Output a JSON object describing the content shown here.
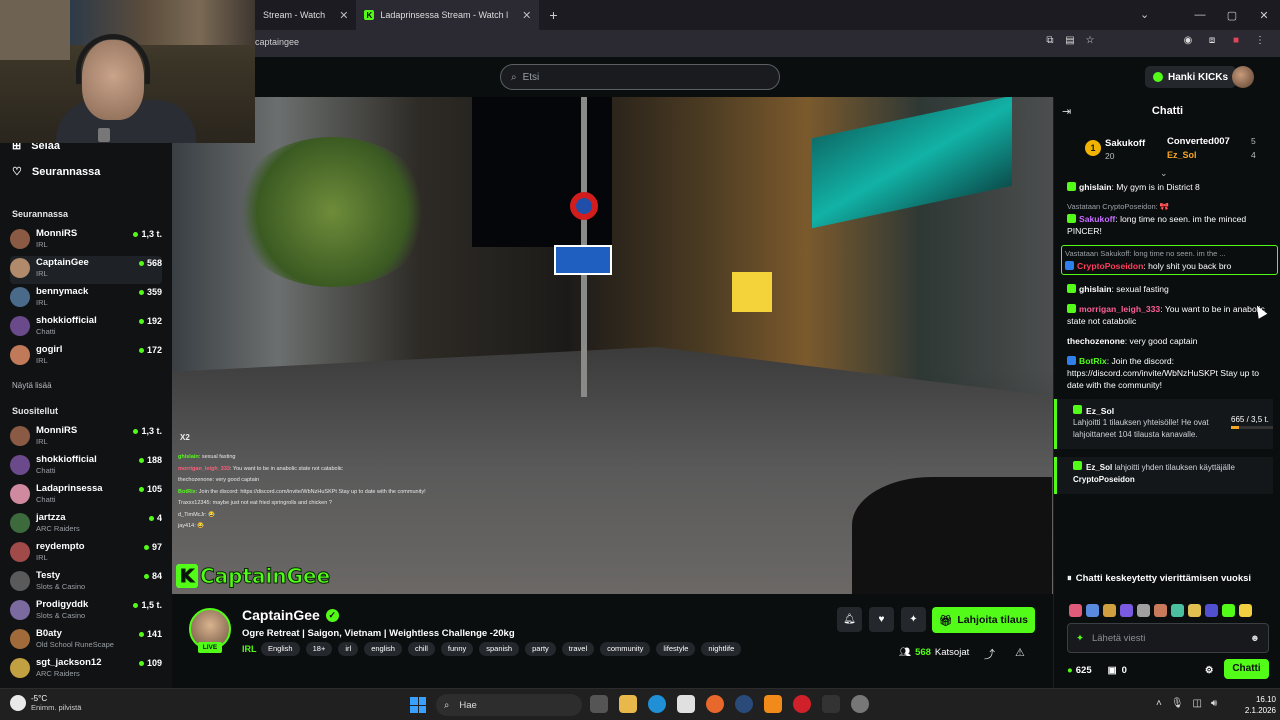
{
  "browser": {
    "tabs": [
      {
        "label": "Stream - Watch"
      },
      {
        "label": "Ladaprinsessa Stream - Watch l"
      }
    ],
    "new_tab": "+",
    "url": "captaingee",
    "window_controls": [
      "⌄",
      "—",
      "▢",
      "✕"
    ]
  },
  "header": {
    "search_placeholder": "Etsi",
    "get_kicks": "Hanki KICKs"
  },
  "sidebar": {
    "nav": [
      {
        "label": "Selaa"
      },
      {
        "label": "Seurannassa"
      }
    ],
    "following_title": "Seurannassa",
    "following": [
      {
        "name": "MonniRS",
        "category": "IRL",
        "viewers": "1,3 t.",
        "color": "#8a5a44"
      },
      {
        "name": "CaptainGee",
        "category": "IRL",
        "viewers": "568",
        "color": "#b08a6a"
      },
      {
        "name": "bennymack",
        "category": "IRL",
        "viewers": "359",
        "color": "#4a6a8a"
      },
      {
        "name": "shokkiofficial",
        "category": "Chatti",
        "viewers": "192",
        "color": "#6a4a8a"
      },
      {
        "name": "gogirl",
        "category": "IRL",
        "viewers": "172",
        "color": "#c07a5a"
      }
    ],
    "show_more": "Näytä lisää",
    "recommended_title": "Suositellut",
    "recommended": [
      {
        "name": "MonniRS",
        "category": "IRL",
        "viewers": "1,3 t.",
        "color": "#8a5a44"
      },
      {
        "name": "shokkiofficial",
        "category": "Chatti",
        "viewers": "188",
        "color": "#6a4a8a"
      },
      {
        "name": "Ladaprinsessa",
        "category": "Chatti",
        "viewers": "105",
        "color": "#d08aa0"
      },
      {
        "name": "jartzza",
        "category": "ARC Raiders",
        "viewers": "4",
        "color": "#3c6a3c"
      },
      {
        "name": "reydempto",
        "category": "IRL",
        "viewers": "97",
        "color": "#a04a4a"
      },
      {
        "name": "Testy",
        "category": "Slots & Casino",
        "viewers": "84",
        "color": "#5a5a5a"
      },
      {
        "name": "Prodigyddk",
        "category": "Slots & Casino",
        "viewers": "1,5 t.",
        "color": "#7a6aa0"
      },
      {
        "name": "B0aty",
        "category": "Old School RuneScape",
        "viewers": "141",
        "color": "#a06a3a"
      },
      {
        "name": "sgt_jackson12",
        "category": "ARC Raiders",
        "viewers": "109",
        "color": "#c0a040"
      }
    ]
  },
  "video": {
    "overlay_x2": "X2",
    "overlay_chat": [
      {
        "user": "ghislain",
        "text": ": sexual fasting",
        "style": "g"
      },
      {
        "user": "morrigan_leigh_333",
        "text": ": You want to be in anabolic state not catabolic",
        "style": "p"
      },
      {
        "user": "thechozenone",
        "text": ": very good captain",
        "style": ""
      },
      {
        "user": "BotRix",
        "text": ": Join the discord: https://discord.com/invite/WbNzHuSKPt Stay up to date with the community!",
        "style": "g"
      },
      {
        "user": "Traxxx12345",
        "text": ": maybe just not eat fried springrolls and chicken ?",
        "style": ""
      },
      {
        "user": "d_TimMcJr",
        "text": ": 😂",
        "style": ""
      },
      {
        "user": "jay414",
        "text": ": 😂",
        "style": ""
      }
    ],
    "logo_text": "CaptainGee"
  },
  "stream": {
    "streamer": "CaptainGee",
    "live": "LIVE",
    "title": "Ogre Retreat | Saigon, Vietnam | Weightless Challenge -20kg",
    "category": "IRL",
    "tags": [
      "English",
      "18+",
      "irl",
      "english",
      "chill",
      "funny",
      "spanish",
      "party",
      "travel",
      "community",
      "lifestyle",
      "nightlife"
    ],
    "subscribe": "Lahjoita tilaus",
    "viewers": "568",
    "viewers_label": "Katsojat"
  },
  "chat": {
    "title": "Chatti",
    "leaderboard": {
      "rank": "1",
      "first_name": "Sakukoff",
      "first_count": "20",
      "second_name": "Converted007",
      "second_count": "5",
      "third_name": "Ez_Sol",
      "third_count": "4"
    },
    "messages": [
      {
        "reply": "",
        "user": "ghislain",
        "color": "#ffffff",
        "badge": "g",
        "text": ": My gym is in District 8"
      },
      {
        "reply": "Vastataan CryptoPoseidon: 🎀",
        "user": "Sakukoff",
        "color": "#c66bff",
        "badge": "g",
        "text": ": long time no seen. im the minced PINCER!"
      },
      {
        "reply": "Vastataan Sakukoff: long time no seen. im the ...",
        "user": "CryptoPoseidon",
        "color": "#ff3b5c",
        "badge": "b",
        "text": ": holy shit you back bro",
        "highlight": true
      },
      {
        "reply": "",
        "user": "ghislain",
        "color": "#ffffff",
        "badge": "g",
        "text": ": sexual fasting"
      },
      {
        "reply": "",
        "user": "morrigan_leigh_333",
        "color": "#ff5f9a",
        "badge": "g",
        "text": ": You want to be in anabolic state not catabolic"
      },
      {
        "reply": "",
        "user": "thechozenone",
        "color": "#ffffff",
        "badge": "",
        "text": ": very good captain"
      },
      {
        "reply": "",
        "user": "BotRix",
        "color": "#53fc18",
        "badge": "b",
        "text": ": Join the discord: https://discord.com/invite/WbNzHuSKPt Stay up to date with the community!"
      }
    ],
    "gift1": {
      "user": "Ez_Sol",
      "text": "Lahjoitti 1 tilauksen yhteisölle! He ovat lahjoittaneet 104 tilausta kanavalle.",
      "progress_label": "665 / 3,5 t.",
      "progress": 0.19
    },
    "gift2": {
      "user": "Ez_Sol",
      "text": "lahjoitti yhden tilauksen käyttäjälle",
      "recipient": "CryptoPoseidon"
    },
    "paused": "Chatti keskeytetty vierittämisen vuoksi",
    "input_placeholder": "Lähetä viesti",
    "kicks": "625",
    "subs": "0",
    "send": "Chatti"
  },
  "taskbar": {
    "temp": "-5°C",
    "weather": "Enimm. pilvistä",
    "search": "Hae",
    "time": "16.10",
    "date": "2.1.2026"
  }
}
